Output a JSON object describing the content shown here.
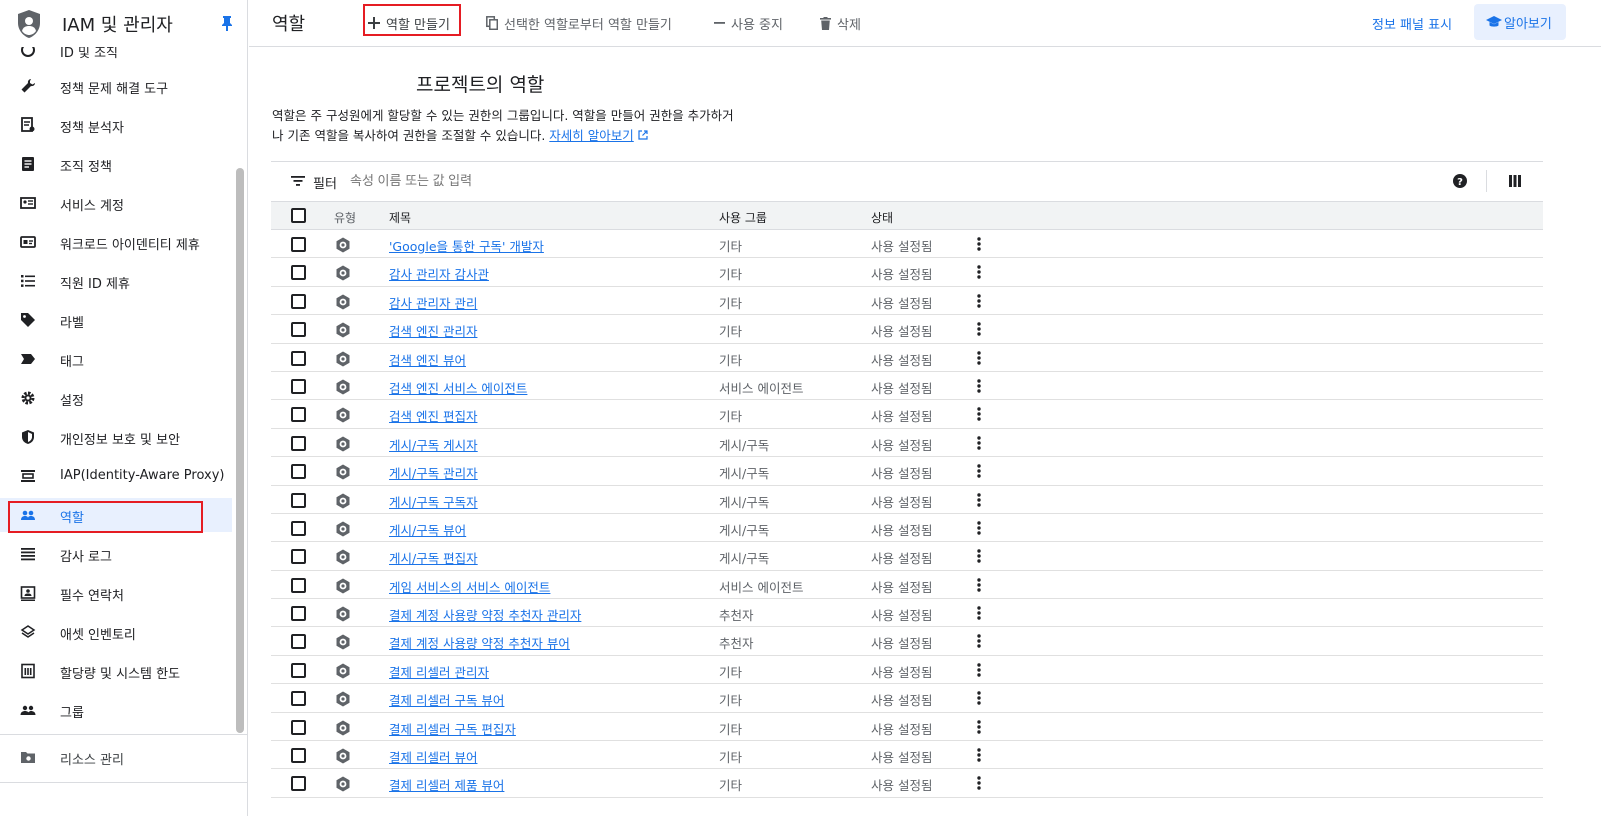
{
  "sidebar": {
    "title": "IAM 및 관리자",
    "partial_top_item": "ID 및 조직",
    "items": [
      {
        "label": "정책 문제 해결 도구",
        "icon": "wrench-icon"
      },
      {
        "label": "정책 분석자",
        "icon": "policy-analyzer-icon"
      },
      {
        "label": "조직 정책",
        "icon": "org-policy-icon"
      },
      {
        "label": "서비스 계정",
        "icon": "service-account-icon"
      },
      {
        "label": "워크로드 아이덴티티 제휴",
        "icon": "workload-identity-icon"
      },
      {
        "label": "직원 ID 제휴",
        "icon": "list-icon"
      },
      {
        "label": "라벨",
        "icon": "label-icon"
      },
      {
        "label": "태그",
        "icon": "tag-icon"
      },
      {
        "label": "설정",
        "icon": "gear-icon"
      },
      {
        "label": "개인정보 보호 및 보안",
        "icon": "shield-icon"
      },
      {
        "label": "IAP(Identity-Aware Proxy)",
        "icon": "iap-icon"
      },
      {
        "label": "역할",
        "icon": "roles-icon",
        "active": true
      },
      {
        "label": "감사 로그",
        "icon": "audit-log-icon"
      },
      {
        "label": "필수 연락처",
        "icon": "contacts-icon"
      },
      {
        "label": "애셋 인벤토리",
        "icon": "asset-inventory-icon"
      },
      {
        "label": "할당량 및 시스템 한도",
        "icon": "quota-icon"
      },
      {
        "label": "그룹",
        "icon": "groups-icon"
      }
    ],
    "footer_item": {
      "label": "리소스 관리",
      "icon": "resource-manager-icon"
    }
  },
  "topbar": {
    "title": "역할",
    "create_role": "역할 만들기",
    "create_from_selection": "선택한 역할로부터 역할 만들기",
    "disable": "사용 중지",
    "delete": "삭제",
    "show_info_panel": "정보 패널 표시",
    "learn": "알아보기"
  },
  "main": {
    "heading": "프로젝트의 역할",
    "desc_line1": "역할은 주 구성원에게 할당할 수 있는 권한의 그룹입니다. 역할을 만들어 권한을 추가하거",
    "desc_line2": "나 기존 역할을 복사하여 권한을 조절할 수 있습니다.",
    "learn_more": "자세히 알아보기",
    "filter_label": "필터",
    "filter_placeholder": "속성 이름 또는 값 입력"
  },
  "table": {
    "headers": {
      "type": "유형",
      "title": "제목",
      "used_in": "사용 그룹",
      "status": "상태"
    },
    "rows": [
      {
        "title": "'Google을 통한 구독' 개발자",
        "group": "기타",
        "status": "사용 설정됨"
      },
      {
        "title": "감사 관리자 감사관",
        "group": "기타",
        "status": "사용 설정됨"
      },
      {
        "title": "감사 관리자 관리",
        "group": "기타",
        "status": "사용 설정됨"
      },
      {
        "title": "검색 엔진 관리자",
        "group": "기타",
        "status": "사용 설정됨"
      },
      {
        "title": "검색 엔진 뷰어",
        "group": "기타",
        "status": "사용 설정됨"
      },
      {
        "title": "검색 엔진 서비스 에이전트",
        "group": "서비스 에이전트",
        "status": "사용 설정됨"
      },
      {
        "title": "검색 엔진 편집자",
        "group": "기타",
        "status": "사용 설정됨"
      },
      {
        "title": "게시/구독 게시자",
        "group": "게시/구독",
        "status": "사용 설정됨"
      },
      {
        "title": "게시/구독 관리자",
        "group": "게시/구독",
        "status": "사용 설정됨"
      },
      {
        "title": "게시/구독 구독자",
        "group": "게시/구독",
        "status": "사용 설정됨"
      },
      {
        "title": "게시/구독 뷰어",
        "group": "게시/구독",
        "status": "사용 설정됨"
      },
      {
        "title": "게시/구독 편집자",
        "group": "게시/구독",
        "status": "사용 설정됨"
      },
      {
        "title": "게임 서비스의 서비스 에이전트",
        "group": "서비스 에이전트",
        "status": "사용 설정됨"
      },
      {
        "title": "결제 계정 사용량 약정 추천자 관리자",
        "group": "추천자",
        "status": "사용 설정됨"
      },
      {
        "title": "결제 계정 사용량 약정 추천자 뷰어",
        "group": "추천자",
        "status": "사용 설정됨"
      },
      {
        "title": "결제 리셀러 관리자",
        "group": "기타",
        "status": "사용 설정됨"
      },
      {
        "title": "결제 리셀러 구독 뷰어",
        "group": "기타",
        "status": "사용 설정됨"
      },
      {
        "title": "결제 리셀러 구독 편집자",
        "group": "기타",
        "status": "사용 설정됨"
      },
      {
        "title": "결제 리셀러 뷰어",
        "group": "기타",
        "status": "사용 설정됨"
      },
      {
        "title": "결제 리셀러 제품 뷰어",
        "group": "기타",
        "status": "사용 설정됨"
      }
    ]
  },
  "colors": {
    "accent": "#1a73e8",
    "highlight": "#e51c23",
    "active_bg": "#e8f0fe"
  }
}
